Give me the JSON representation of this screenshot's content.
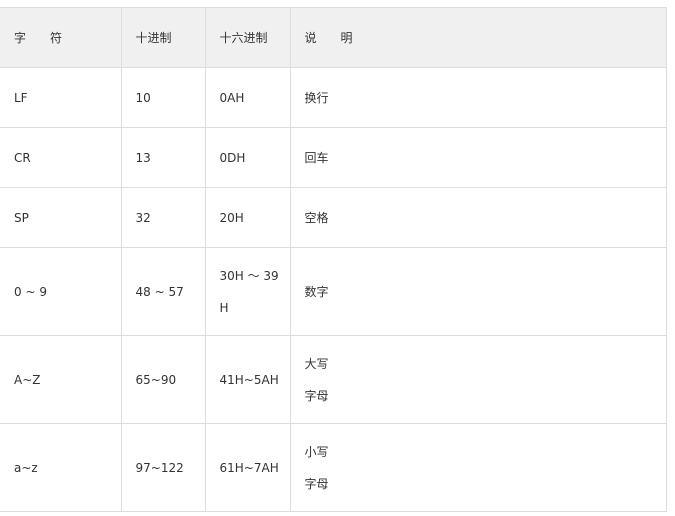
{
  "table": {
    "headers": [
      "字　　符",
      "十进制",
      "十六进制",
      "说　　明"
    ],
    "rows": [
      {
        "char": "LF",
        "dec": "10",
        "hex": "0AH",
        "desc": "换行"
      },
      {
        "char": "CR",
        "dec": "13",
        "hex": "0DH",
        "desc": "回车"
      },
      {
        "char": "SP",
        "dec": "32",
        "hex": "20H",
        "desc": "空格"
      },
      {
        "char": "0 ~ 9",
        "dec": "48 ~ 57",
        "hex": "30H ～ 39H",
        "desc": "数字"
      },
      {
        "char": "A~Z",
        "dec": "65~90",
        "hex": "41H~5AH",
        "desc": "大写字母"
      },
      {
        "char": "a~z",
        "dec": "97~122",
        "hex": "61H~7AH",
        "desc": "小写字母"
      }
    ]
  }
}
